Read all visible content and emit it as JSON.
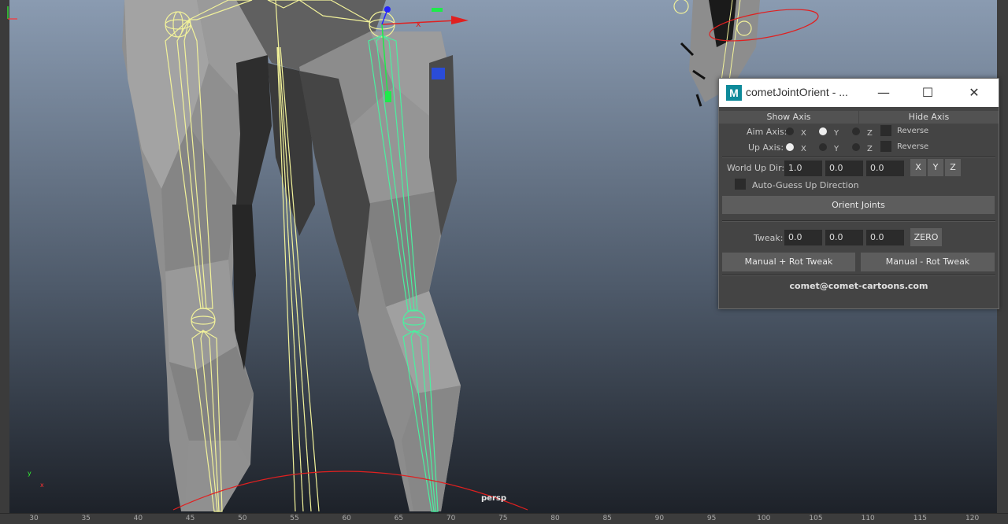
{
  "viewport": {
    "camera_label": "persp",
    "axis_labels": {
      "x": "x",
      "y": "y"
    },
    "timeline_ticks": [
      "30",
      "35",
      "40",
      "45",
      "50",
      "55",
      "60",
      "65",
      "70",
      "75",
      "80",
      "85",
      "90",
      "95",
      "100",
      "105",
      "110",
      "115",
      "120"
    ]
  },
  "dialog": {
    "app_icon": "M",
    "title": "cometJointOrient - ...",
    "tabs": {
      "show_axis": "Show Axis",
      "hide_axis": "Hide Axis"
    },
    "aim_axis": {
      "label": "Aim Axis:",
      "x": "X",
      "y": "Y",
      "z": "Z",
      "selected": "Y",
      "reverse_label": "Reverse"
    },
    "up_axis": {
      "label": "Up  Axis:",
      "x": "X",
      "y": "Y",
      "z": "Z",
      "selected": "X",
      "reverse_label": "Reverse"
    },
    "world_up": {
      "label": "World Up Dir:",
      "x": "1.0",
      "y": "0.0",
      "z": "0.0",
      "btn_x": "X",
      "btn_y": "Y",
      "btn_z": "Z"
    },
    "auto_guess_label": "Auto-Guess Up Direction",
    "orient_button": "Orient Joints",
    "tweak": {
      "label": "Tweak:",
      "x": "0.0",
      "y": "0.0",
      "z": "0.0",
      "zero_button": "ZERO"
    },
    "manual_plus": "Manual + Rot Tweak",
    "manual_minus": "Manual - Rot Tweak",
    "email": "comet@comet-cartoons.com"
  },
  "colors": {
    "viewport_top": "#8a9bb1",
    "viewport_bottom": "#1b1f26",
    "joint_yellow": "#f2f29a",
    "joint_green": "#4bf0a0",
    "accent_red": "#e02020"
  },
  "icons": [
    "minimize-icon",
    "maximize-icon",
    "close-icon",
    "move-manipulator-icon",
    "axis-gizmo-icon"
  ]
}
